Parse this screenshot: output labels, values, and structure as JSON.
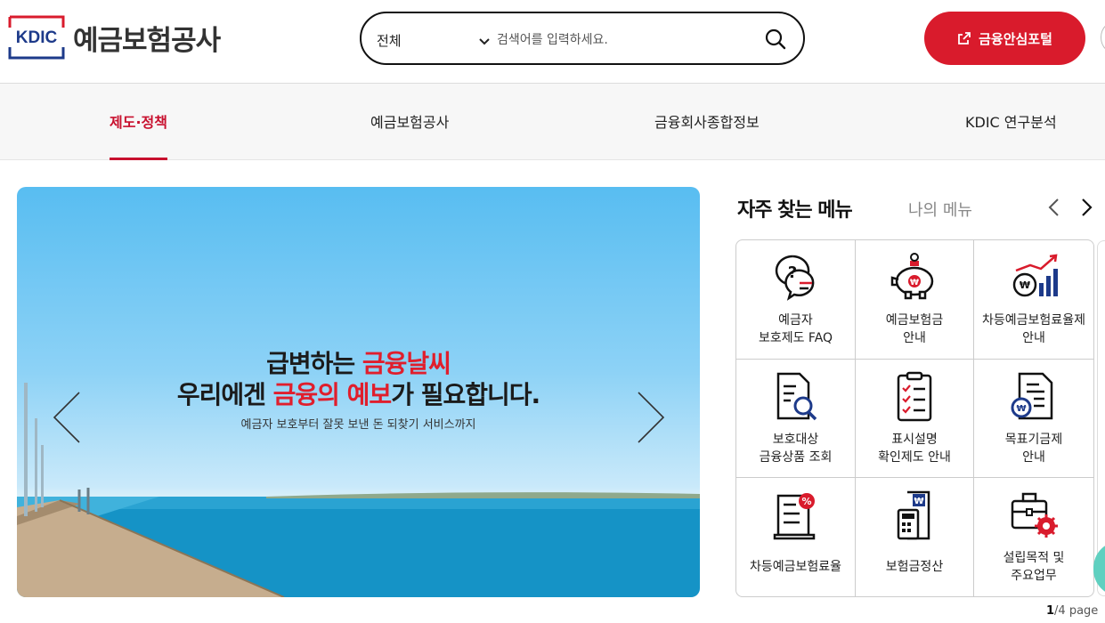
{
  "header": {
    "logo_text": "KDIC",
    "org_name": "예금보험공사",
    "search": {
      "scope": "전체",
      "placeholder": "검색어를 입력하세요."
    },
    "portal_button": "금융안심포털"
  },
  "nav": {
    "items": [
      {
        "label": "제도·정책",
        "active": true
      },
      {
        "label": "예금보험공사",
        "active": false
      },
      {
        "label": "금융회사종합정보",
        "active": false
      },
      {
        "label": "KDIC 연구분석",
        "active": false
      }
    ]
  },
  "banner": {
    "headline1_a": "급변하는 ",
    "headline1_b": "금융날씨",
    "headline2_a": "우리에겐 ",
    "headline2_b": "금융의 예보",
    "headline2_c": "가 필요합니다.",
    "subtext": "예금자 보호부터 잘못 보낸 돈 되찾기 서비스까지"
  },
  "quick_menu": {
    "title": "자주 찾는 메뉴",
    "my_menu": "나의 메뉴",
    "items": [
      {
        "label": "예금자\n보호제도 FAQ",
        "icon": "faq-chat-icon"
      },
      {
        "label": "예금보험금\n안내",
        "icon": "piggy-bank-icon"
      },
      {
        "label": "차등예금보험료율제\n안내",
        "icon": "coin-chart-icon"
      },
      {
        "label": "보호대상\n금융상품 조회",
        "icon": "document-search-icon"
      },
      {
        "label": "표시설명\n확인제도 안내",
        "icon": "checklist-icon"
      },
      {
        "label": "목표기금제\n안내",
        "icon": "won-document-icon"
      },
      {
        "label": "차등예금보험료율",
        "icon": "percent-document-icon"
      },
      {
        "label": "보험금정산",
        "icon": "calculator-icon"
      },
      {
        "label": "설립목적 및\n주요업무",
        "icon": "briefcase-gear-icon"
      }
    ],
    "pager_current": "1",
    "pager_total": "/4 page"
  },
  "colors": {
    "accent": "#d91b2c",
    "logo_blue": "#1d3a8a"
  }
}
